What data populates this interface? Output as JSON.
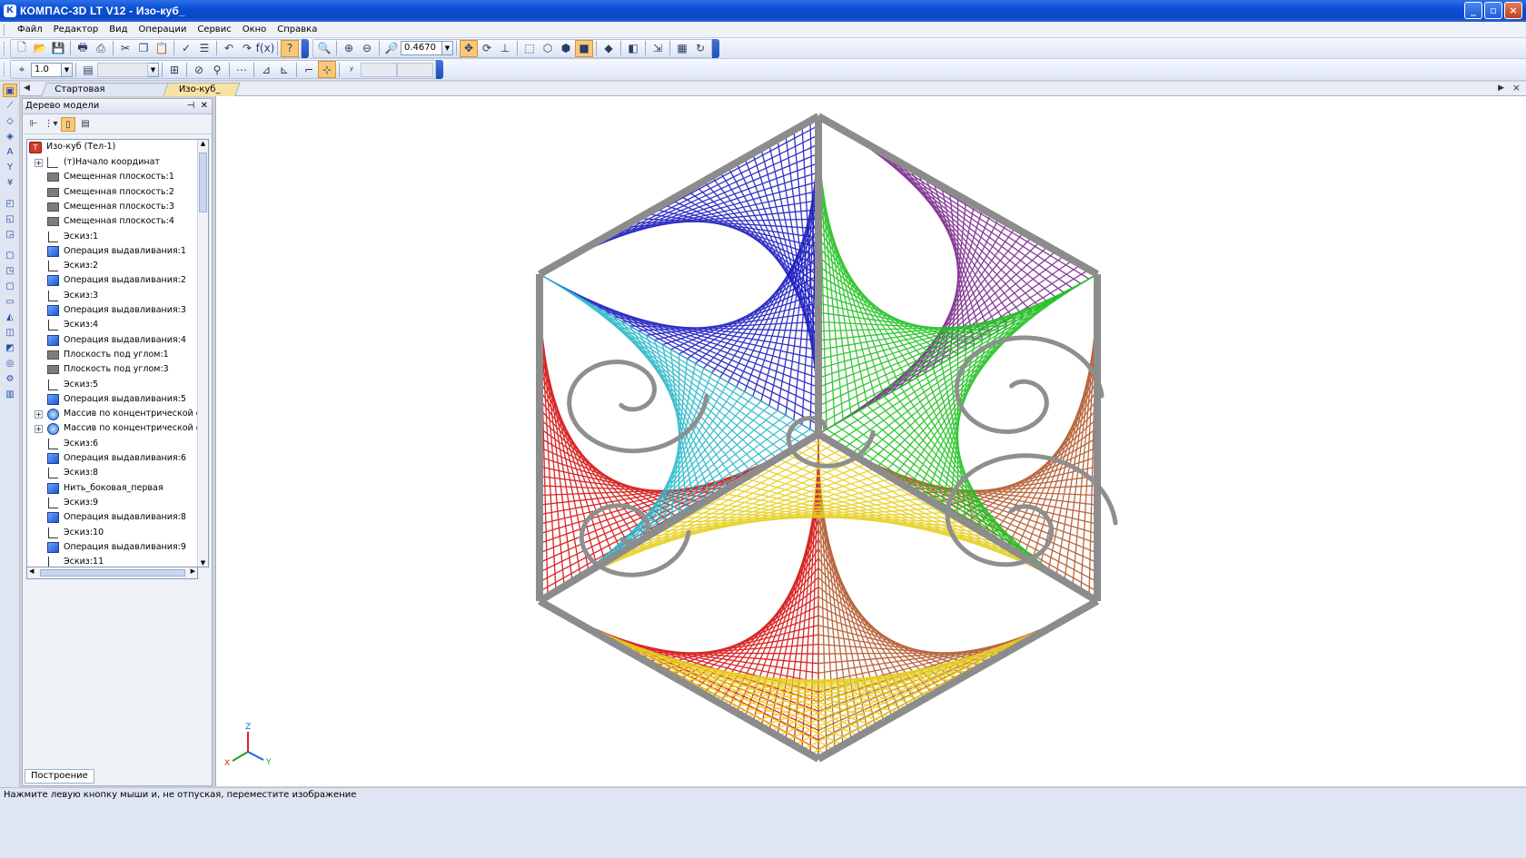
{
  "window": {
    "title": "КОМПАС-3D LT V12 - Изо-куб_"
  },
  "menu": [
    "Файл",
    "Редактор",
    "Вид",
    "Операции",
    "Сервис",
    "Окно",
    "Справка"
  ],
  "toolbar": {
    "zoom_value": "0.4670",
    "step_value": "1.0"
  },
  "tabs": [
    {
      "label": "Стартовая страница",
      "active": false
    },
    {
      "label": "Изо-куб_",
      "active": true
    }
  ],
  "panel": {
    "title": "Дерево модели",
    "bottom_tab": "Построение"
  },
  "tree": {
    "root": "Изо-куб (Тел-1)",
    "items": [
      {
        "label": "(т)Начало координат",
        "icon": "origin-icon",
        "expandable": true
      },
      {
        "label": "Смещенная плоскость:1",
        "icon": "plane-icon",
        "expandable": false
      },
      {
        "label": "Смещенная плоскость:2",
        "icon": "plane-icon",
        "expandable": false
      },
      {
        "label": "Смещенная плоскость:3",
        "icon": "plane-icon",
        "expandable": false
      },
      {
        "label": "Смещенная плоскость:4",
        "icon": "plane-icon",
        "expandable": false
      },
      {
        "label": "Эскиз:1",
        "icon": "sketch-icon",
        "expandable": false
      },
      {
        "label": "Операция выдавливания:1",
        "icon": "extrude-icon",
        "expandable": false
      },
      {
        "label": "Эскиз:2",
        "icon": "sketch-icon",
        "expandable": false
      },
      {
        "label": "Операция выдавливания:2",
        "icon": "extrude-icon",
        "expandable": false
      },
      {
        "label": "Эскиз:3",
        "icon": "sketch-icon",
        "expandable": false
      },
      {
        "label": "Операция выдавливания:3",
        "icon": "extrude-icon",
        "expandable": false
      },
      {
        "label": "Эскиз:4",
        "icon": "sketch-icon",
        "expandable": false
      },
      {
        "label": "Операция выдавливания:4",
        "icon": "extrude-icon",
        "expandable": false
      },
      {
        "label": "Плоскость под углом:1",
        "icon": "plane-icon",
        "expandable": false
      },
      {
        "label": "Плоскость под углом:3",
        "icon": "plane-icon",
        "expandable": false
      },
      {
        "label": "Эскиз:5",
        "icon": "sketch-icon",
        "expandable": false
      },
      {
        "label": "Операция выдавливания:5",
        "icon": "extrude-icon",
        "expandable": false
      },
      {
        "label": "Массив по концентрической сетке",
        "icon": "array-icon",
        "expandable": true
      },
      {
        "label": "Массив по концентрической сетке",
        "icon": "array-icon",
        "expandable": true
      },
      {
        "label": "Эскиз:6",
        "icon": "sketch-icon",
        "expandable": false
      },
      {
        "label": "Операция выдавливания:6",
        "icon": "extrude-icon",
        "expandable": false
      },
      {
        "label": "Эскиз:8",
        "icon": "sketch-icon",
        "expandable": false
      },
      {
        "label": "Нить_боковая_первая",
        "icon": "extrude-icon",
        "expandable": false
      },
      {
        "label": "Эскиз:9",
        "icon": "sketch-icon",
        "expandable": false
      },
      {
        "label": "Операция выдавливания:8",
        "icon": "extrude-icon",
        "expandable": false
      },
      {
        "label": "Эскиз:10",
        "icon": "sketch-icon",
        "expandable": false
      },
      {
        "label": "Операция выдавливания:9",
        "icon": "extrude-icon",
        "expandable": false
      },
      {
        "label": "Эскиз:11",
        "icon": "sketch-icon",
        "expandable": false
      }
    ]
  },
  "triad": {
    "x": "X",
    "y": "Y",
    "z": "Z"
  },
  "status": {
    "text": "Нажмите левую кнопку мыши и, не отпуская, переместите изображение"
  },
  "colors": {
    "frame": "#8c8c8c",
    "blue": "#1c1cc0",
    "cyan": "#2ab8c8",
    "green": "#20c020",
    "red": "#d41010",
    "yellow": "#e6d020",
    "brown": "#b0562a",
    "purple": "#7a2a8a"
  }
}
